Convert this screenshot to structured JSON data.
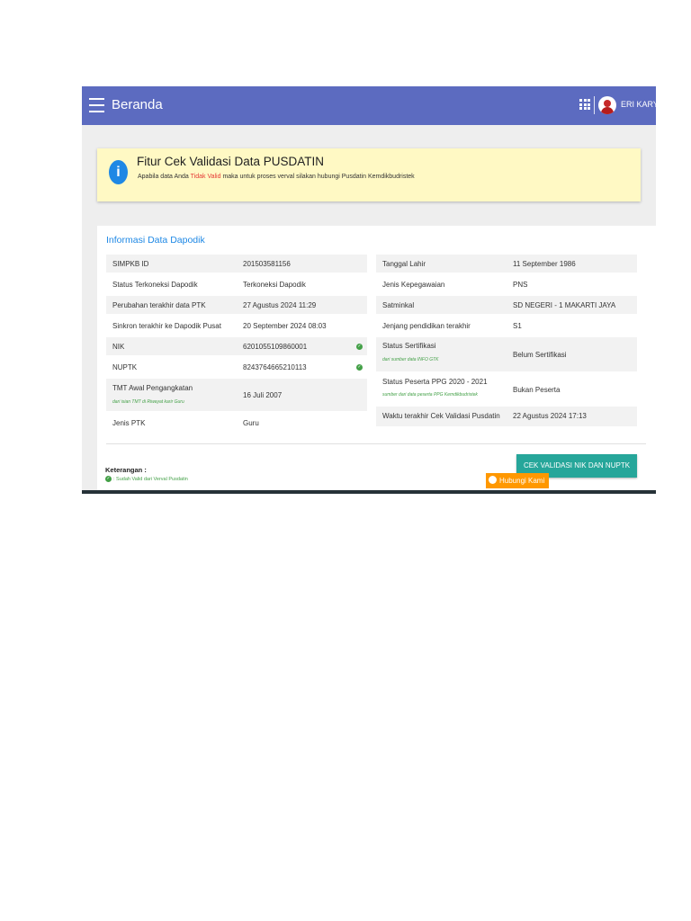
{
  "topbar": {
    "title": "Beranda",
    "user_name": "ERI KARYATI",
    "icons": [
      "menu-icon",
      "apps-icon",
      "avatar"
    ]
  },
  "alert": {
    "title": "Fitur Cek Validasi Data PUSDATIN",
    "text_before": "Apabila data Anda ",
    "text_highlight": "Tidak Valid",
    "text_after": " maka untuk proses verval silakan hubungi Pusdatin Kemdikbudristek",
    "highlight_color": "#e53935"
  },
  "card": {
    "title": "Informasi Data Dapodik",
    "left_rows": [
      {
        "label": "SIMPKB ID",
        "value": "201503581156"
      },
      {
        "label": "Status Terkoneksi Dapodik",
        "value": "Terkoneksi Dapodik"
      },
      {
        "label": "Perubahan terakhir data PTK",
        "value": "27 Agustus 2024 11:29"
      },
      {
        "label": "Sinkron terakhir ke Dapodik Pusat",
        "value": "20 September 2024 08:03"
      },
      {
        "label": "NIK",
        "value": "6201055109860001"
      },
      {
        "label": "NUPTK",
        "value": "8243764665210113"
      },
      {
        "label": "TMT Awal Pengangkatan",
        "note": "dari isian TMT di Riwayat karir Guru",
        "value": "16 Juli 2007"
      },
      {
        "label": "Jenis PTK",
        "value": "Guru"
      }
    ],
    "right_rows": [
      {
        "label": "Tanggal Lahir",
        "value": "11 September 1986"
      },
      {
        "label": "Jenis Kepegawaian",
        "value": "PNS"
      },
      {
        "label": "Satminkal",
        "value": "SD NEGERI - 1 MAKARTI JAYA"
      },
      {
        "label": "Jenjang pendidikan terakhir",
        "value": "S1"
      },
      {
        "label": "Status Sertifikasi",
        "note": "dari sumber data INFO GTK",
        "value": "Belum Sertifikasi"
      },
      {
        "label": "Status Peserta PPG 2020 - 2021",
        "note": "sumber dari data peserta PPG Kemdikbudristek",
        "value": "Bukan Peserta"
      },
      {
        "label": "Waktu terakhir Cek Validasi Pusdatin",
        "value": "22 Agustus 2024 17:13"
      }
    ],
    "keterangan_label": "Keterangan :",
    "legend_valid": ": Sudah Valid dari Verval Pusdatin",
    "check_color": "#43a047"
  },
  "buttons": {
    "cek_validasi": "CEK VALIDASI NIK DAN NUPTK",
    "hubungi": "Hubungi Kami"
  },
  "colors": {
    "topbar": "#5c6bc0",
    "accent_blue": "#1e88e5",
    "alert_bg": "#fff9c4",
    "button_teal": "#26a69a",
    "hubungi_orange": "#ff9800"
  }
}
